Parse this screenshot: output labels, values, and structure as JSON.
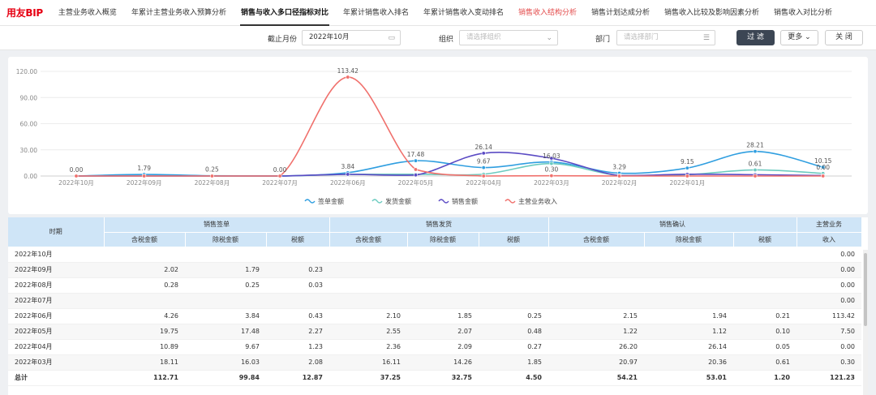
{
  "nav": {
    "logo": "用友BIP",
    "tabs": [
      {
        "label": "主营业务收入概览",
        "state": "normal"
      },
      {
        "label": "年累计主营业务收入预算分析",
        "state": "normal"
      },
      {
        "label": "销售与收入多口径指标对比",
        "state": "active"
      },
      {
        "label": "年累计销售收入排名",
        "state": "normal"
      },
      {
        "label": "年累计销售收入变动排名",
        "state": "normal"
      },
      {
        "label": "销售收入结构分析",
        "state": "red"
      },
      {
        "label": "销售计划达成分析",
        "state": "normal"
      },
      {
        "label": "销售收入比较及影响因素分析",
        "state": "normal"
      },
      {
        "label": "销售收入对比分析",
        "state": "normal"
      }
    ]
  },
  "filters": {
    "month_label": "截止月份",
    "month_value": "2022年10月",
    "org_label": "组织",
    "org_placeholder": "请选择组织",
    "dept_label": "部门",
    "dept_placeholder": "请选择部门",
    "filter_button": "过 滤",
    "more_button": "更多",
    "close_button": "关 闭"
  },
  "chart_data": {
    "type": "line",
    "categories": [
      "2022年10月",
      "2022年09月",
      "2022年08月",
      "2022年07月",
      "2022年06月",
      "2022年05月",
      "2022年04月",
      "2022年03月",
      "2022年02月",
      "2022年01月"
    ],
    "ylim": [
      0,
      120
    ],
    "yticks": [
      "0.00",
      "30.00",
      "60.00",
      "90.00",
      "120.00"
    ],
    "legend_position": "bottom",
    "series": [
      {
        "name": "签单金额",
        "color": "#2f9ee0",
        "values": [
          0,
          1.79,
          0.25,
          0,
          3.84,
          17.48,
          9.67,
          16.03,
          3.29,
          9.15,
          28.21,
          10.15
        ]
      },
      {
        "name": "发货金额",
        "color": "#6ccbc0",
        "values": [
          0,
          0,
          0,
          0,
          1.85,
          2.07,
          2.09,
          14.26,
          0.5,
          1.5,
          7.0,
          3.0
        ]
      },
      {
        "name": "销售金额",
        "color": "#5b4bc4",
        "values": [
          0,
          0,
          0,
          0,
          1.94,
          1.12,
          26.14,
          20.36,
          0.5,
          2.0,
          1.5,
          0.5
        ]
      },
      {
        "name": "主营业务收入",
        "color": "#f0706c",
        "values": [
          0,
          0,
          0,
          0,
          113.42,
          7.5,
          0,
          0.3,
          0,
          0,
          0,
          0
        ]
      }
    ],
    "data_labels": [
      {
        "i": 0,
        "v": 0,
        "text": "0.00"
      },
      {
        "i": 1,
        "v": 1.79,
        "text": "1.79"
      },
      {
        "i": 2,
        "v": 0.25,
        "text": "0.25"
      },
      {
        "i": 3,
        "v": 0,
        "text": "0.00"
      },
      {
        "i": 4,
        "v": 113.42,
        "text": "113.42"
      },
      {
        "i": 4,
        "v": 3.84,
        "text": "3.84"
      },
      {
        "i": 5,
        "v": 17.48,
        "text": "17.48"
      },
      {
        "i": 6,
        "v": 26.14,
        "text": "26.14"
      },
      {
        "i": 6,
        "v": 9.67,
        "text": "9.67"
      },
      {
        "i": 7,
        "v": 16.03,
        "text": "16.03"
      },
      {
        "i": 7,
        "v": 0.3,
        "text": "0.30"
      },
      {
        "i": 8,
        "v": 3.29,
        "text": "3.29"
      },
      {
        "i": 9,
        "v": 9.15,
        "text": "9.15"
      },
      {
        "i": 10,
        "v": 28.21,
        "text": "28.21"
      },
      {
        "i": 10,
        "v": 7.0,
        "text": "0.61"
      },
      {
        "i": 11,
        "v": 10.15,
        "text": "10.15"
      },
      {
        "i": 11,
        "v": 3.0,
        "text": "0.00"
      }
    ]
  },
  "table": {
    "group_headers": {
      "period": "时期",
      "sign": "销售签单",
      "ship": "销售发货",
      "confirm": "销售确认",
      "main": "主营业务"
    },
    "sub_headers": [
      "含税金额",
      "除税金额",
      "税额",
      "含税金额",
      "除税金额",
      "税额",
      "含税金额",
      "除税金额",
      "税额",
      "收入"
    ],
    "rows": [
      [
        "2022年10月",
        "",
        "",
        "",
        "",
        "",
        "",
        "",
        "",
        "",
        "0.00"
      ],
      [
        "2022年09月",
        "2.02",
        "1.79",
        "0.23",
        "",
        "",
        "",
        "",
        "",
        "",
        "0.00"
      ],
      [
        "2022年08月",
        "0.28",
        "0.25",
        "0.03",
        "",
        "",
        "",
        "",
        "",
        "",
        "0.00"
      ],
      [
        "2022年07月",
        "",
        "",
        "",
        "",
        "",
        "",
        "",
        "",
        "",
        "0.00"
      ],
      [
        "2022年06月",
        "4.26",
        "3.84",
        "0.43",
        "2.10",
        "1.85",
        "0.25",
        "2.15",
        "1.94",
        "0.21",
        "113.42"
      ],
      [
        "2022年05月",
        "19.75",
        "17.48",
        "2.27",
        "2.55",
        "2.07",
        "0.48",
        "1.22",
        "1.12",
        "0.10",
        "7.50"
      ],
      [
        "2022年04月",
        "10.89",
        "9.67",
        "1.23",
        "2.36",
        "2.09",
        "0.27",
        "26.20",
        "26.14",
        "0.05",
        "0.00"
      ],
      [
        "2022年03月",
        "18.11",
        "16.03",
        "2.08",
        "16.11",
        "14.26",
        "1.85",
        "20.97",
        "20.36",
        "0.61",
        "0.30"
      ]
    ],
    "total": [
      "总计",
      "112.71",
      "99.84",
      "12.87",
      "37.25",
      "32.75",
      "4.50",
      "54.21",
      "53.01",
      "1.20",
      "121.23"
    ]
  }
}
